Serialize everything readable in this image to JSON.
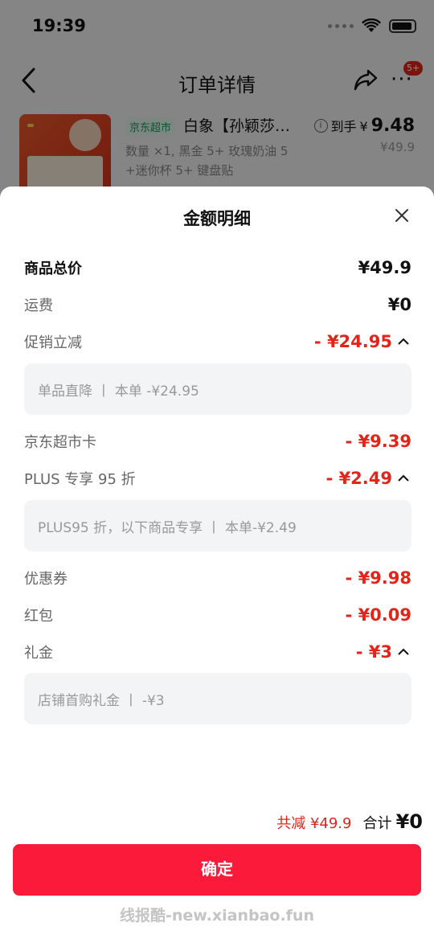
{
  "status_bar": {
    "time": "19:39"
  },
  "nav": {
    "title": "订单详情",
    "badge": "5+"
  },
  "product": {
    "tag": "京东超市",
    "name": "白象【孙颖莎…",
    "spec": "数量 ×1, 黑金 5+ 玫瑰奶油 5 +迷你杯 5+ 键盘贴",
    "price_label": "到手",
    "price_currency": "¥",
    "price_value": "9.48",
    "original_price": "¥49.9"
  },
  "sheet": {
    "title": "金额明细",
    "rows": [
      {
        "label": "商品总价",
        "value": "¥49.9"
      },
      {
        "label": "运费",
        "value": "¥0"
      },
      {
        "label": "促销立减",
        "value": "- ¥24.95",
        "detail": "单品直降 丨 本单 -¥24.95"
      },
      {
        "label": "京东超市卡",
        "value": "- ¥9.39"
      },
      {
        "label": "PLUS 专享 95 折",
        "value": "- ¥2.49",
        "detail": "PLUS95 折，以下商品专享 丨 本单-¥2.49"
      },
      {
        "label": "优惠券",
        "value": "- ¥9.98"
      },
      {
        "label": "红包",
        "value": "- ¥0.09"
      },
      {
        "label": "礼金",
        "value": "- ¥3",
        "detail": "店铺首购礼金 丨 -¥3"
      }
    ],
    "summary": {
      "saved": "共减 ¥49.9",
      "total_label": "合计",
      "total_value": "¥0"
    },
    "confirm_label": "确定"
  },
  "watermark": "线报酷-new.xianbao.fun",
  "colors": {
    "accent_red": "#e1251b",
    "button_red": "#fb1a3a",
    "detail_bg": "#f3f4f6"
  }
}
